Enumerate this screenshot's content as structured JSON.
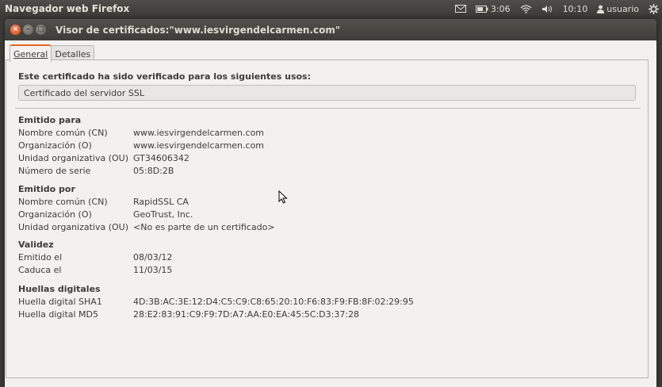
{
  "panel": {
    "app_title": "Navegador web Firefox",
    "battery_time": "3:06",
    "clock": "10:10",
    "user": "usuario"
  },
  "dialog": {
    "title": "Visor de certificados:\"www.iesvirgendelcarmen.com\""
  },
  "tabs": [
    {
      "label": "General",
      "active": true
    },
    {
      "label": "Detalles",
      "active": false
    }
  ],
  "usage": {
    "heading": "Este certificado ha sido verificado para los siguientes usos:",
    "value": "Certificado del servidor SSL"
  },
  "issued_to": {
    "heading": "Emitido para",
    "rows": [
      {
        "label": "Nombre común (CN)",
        "value": "www.iesvirgendelcarmen.com"
      },
      {
        "label": "Organización (O)",
        "value": "www.iesvirgendelcarmen.com"
      },
      {
        "label": "Unidad organizativa (OU)",
        "value": "GT34606342"
      },
      {
        "label": "Número de serie",
        "value": "05:8D:2B"
      }
    ]
  },
  "issued_by": {
    "heading": "Emitido por",
    "rows": [
      {
        "label": "Nombre común (CN)",
        "value": "RapidSSL CA"
      },
      {
        "label": "Organización (O)",
        "value": "GeoTrust, Inc."
      },
      {
        "label": "Unidad organizativa (OU)",
        "value": "<No es parte de un certificado>"
      }
    ]
  },
  "validity": {
    "heading": "Validez",
    "rows": [
      {
        "label": "Emitido el",
        "value": "08/03/12"
      },
      {
        "label": "Caduca el",
        "value": "11/03/15"
      }
    ]
  },
  "fingerprints": {
    "heading": "Huellas digitales",
    "rows": [
      {
        "label": "Huella digital SHA1",
        "value": "4D:3B:AC:3E:12:D4:C5:C9:C8:65:20:10:F6:83:F9:FB:8F:02:29:95"
      },
      {
        "label": "Huella digital MD5",
        "value": "28:E2:83:91:C9:F9:7D:A7:AA:E0:EA:45:5C:D3:37:28"
      }
    ]
  },
  "colors": {
    "accent_tab": "#e2661f",
    "close_button": "#df4a16"
  }
}
